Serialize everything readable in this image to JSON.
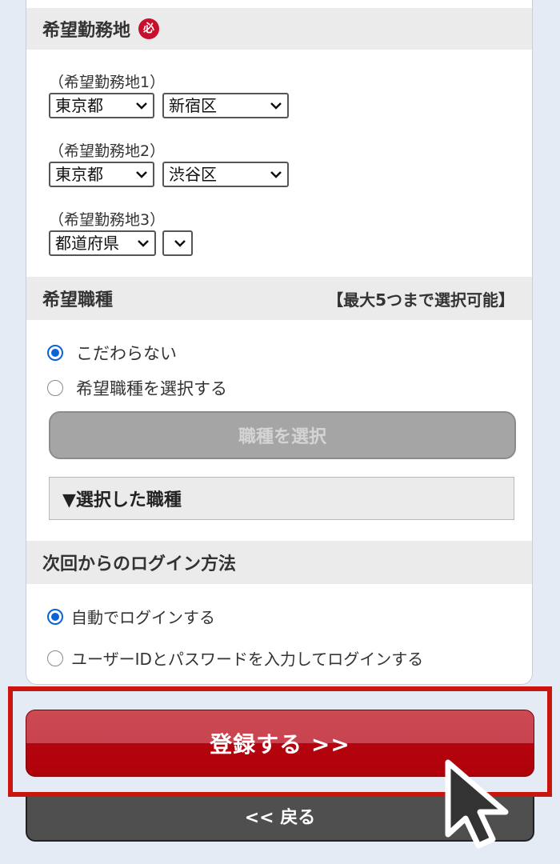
{
  "location_section": {
    "title": "希望勤務地",
    "required_badge": "必",
    "locations": [
      {
        "label": "（希望勤務地1）",
        "prefecture": "東京都",
        "city": "新宿区"
      },
      {
        "label": "（希望勤務地2）",
        "prefecture": "東京都",
        "city": "渋谷区"
      },
      {
        "label": "（希望勤務地3）",
        "prefecture": "都道府県",
        "city": ""
      }
    ]
  },
  "job_section": {
    "title": "希望職種",
    "max_note": "【最大5つまで選択可能】",
    "options": [
      {
        "label": "こだわらない",
        "checked": true
      },
      {
        "label": "希望職種を選択する",
        "checked": false
      }
    ],
    "select_button": "職種を選択",
    "selected_toggle": "▼選択した職種"
  },
  "login_section": {
    "title": "次回からのログイン方法",
    "options": [
      {
        "label": "自動でログインする",
        "checked": true
      },
      {
        "label": "ユーザーIDとパスワードを入力してログインする",
        "checked": false
      }
    ]
  },
  "actions": {
    "register": "登録する >>",
    "back": "<< 戻る"
  },
  "icons": {
    "select_arrow": "chevron-down-icon",
    "cursor": "mouse-pointer-icon"
  },
  "colors": {
    "accent_red": "#b0000a",
    "highlight_border": "#c8160e",
    "radio_blue": "#0a62d8",
    "disabled_button": "#a5a5a5"
  }
}
